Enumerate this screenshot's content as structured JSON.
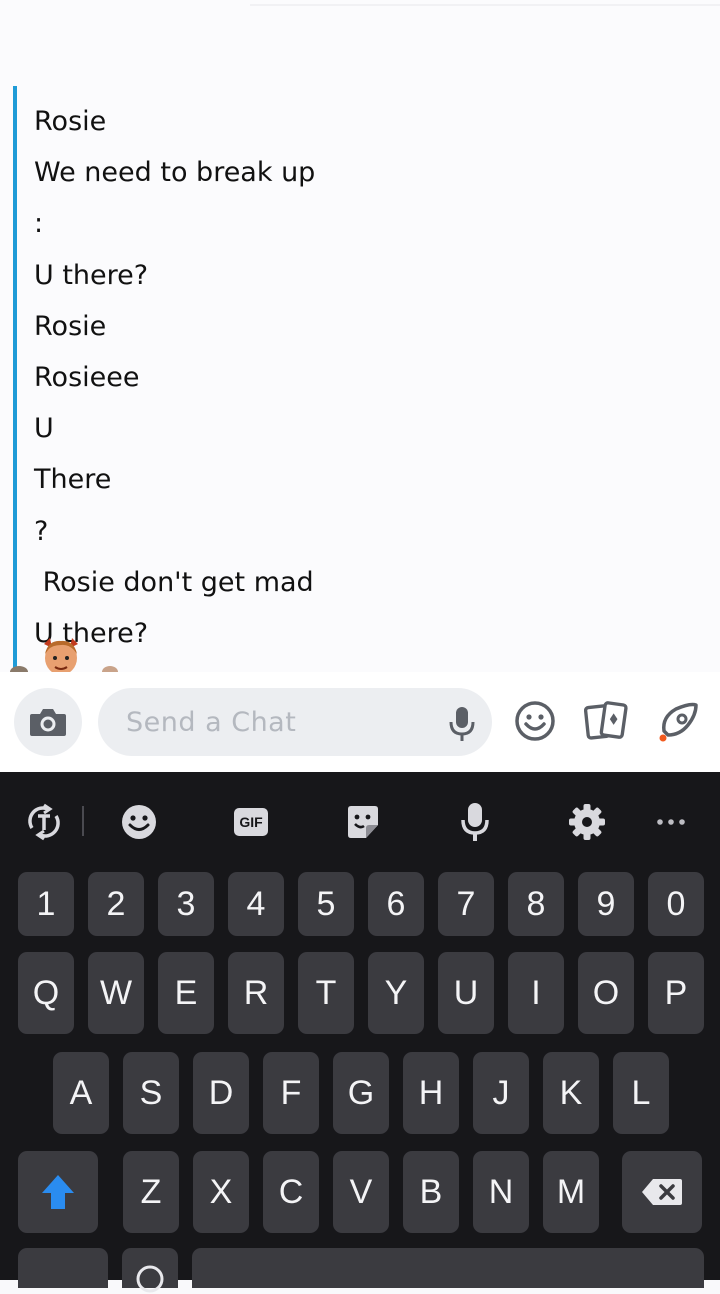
{
  "chat": {
    "messages": [
      "Rosie",
      "We need to break up",
      ":",
      "U there?",
      "Rosie",
      "Rosieee",
      "U",
      "There",
      "?",
      " Rosie don't get mad",
      "U there?"
    ]
  },
  "input": {
    "placeholder": "Send a Chat"
  },
  "keyboard": {
    "numbers": [
      "1",
      "2",
      "3",
      "4",
      "5",
      "6",
      "7",
      "8",
      "9",
      "0"
    ],
    "row1": [
      "Q",
      "W",
      "E",
      "R",
      "T",
      "Y",
      "U",
      "I",
      "O",
      "P"
    ],
    "row2": [
      "A",
      "S",
      "D",
      "F",
      "G",
      "H",
      "J",
      "K",
      "L"
    ],
    "row3": [
      "Z",
      "X",
      "C",
      "V",
      "B",
      "N",
      "M"
    ],
    "gif_label": "GIF"
  },
  "colors": {
    "accent_bar": "#1f9bd7",
    "keyboard_bg": "#17171a",
    "key_bg": "#3b3b40",
    "shift_blue": "#2a8cf0"
  }
}
